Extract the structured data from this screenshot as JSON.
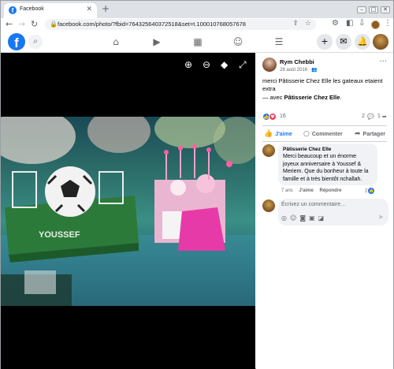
{
  "browser": {
    "tab_title": "Facebook",
    "tab_favicon": "f",
    "url": "facebook.com/photo/?fbid=764325640372518&set=t.100010768057678"
  },
  "fb": {
    "logo": "f"
  },
  "post": {
    "author": "Rym Chebbi",
    "date": "28 août 2016 · ",
    "caption": "merci Pâtisserie Chez Elle les gateaux etaient extra",
    "with_prefix": "— avec ",
    "with_name": "Pâtisserie Chez Elle",
    "with_suffix": ".",
    "reaction_count": "16",
    "comment_count": "2",
    "share_count": "1",
    "actions": {
      "like": "J'aime",
      "comment": "Commenter",
      "share": "Partager"
    }
  },
  "comment": {
    "author": "Pâtisserie Chez Elle",
    "text": "Merci beaucoup et un énorme joyeux anniversaire à Youssef & Meriem. Que du bonheur à toute la famille et à très bientôt nchallah.",
    "age": "7 ans",
    "like_label": "J'aime",
    "reply_label": "Répondre",
    "like_count": "2"
  },
  "composer": {
    "placeholder": "Écrivez un commentaire…"
  },
  "colors": {
    "fb_blue": "#1877f2",
    "love_red": "#f33e58"
  }
}
